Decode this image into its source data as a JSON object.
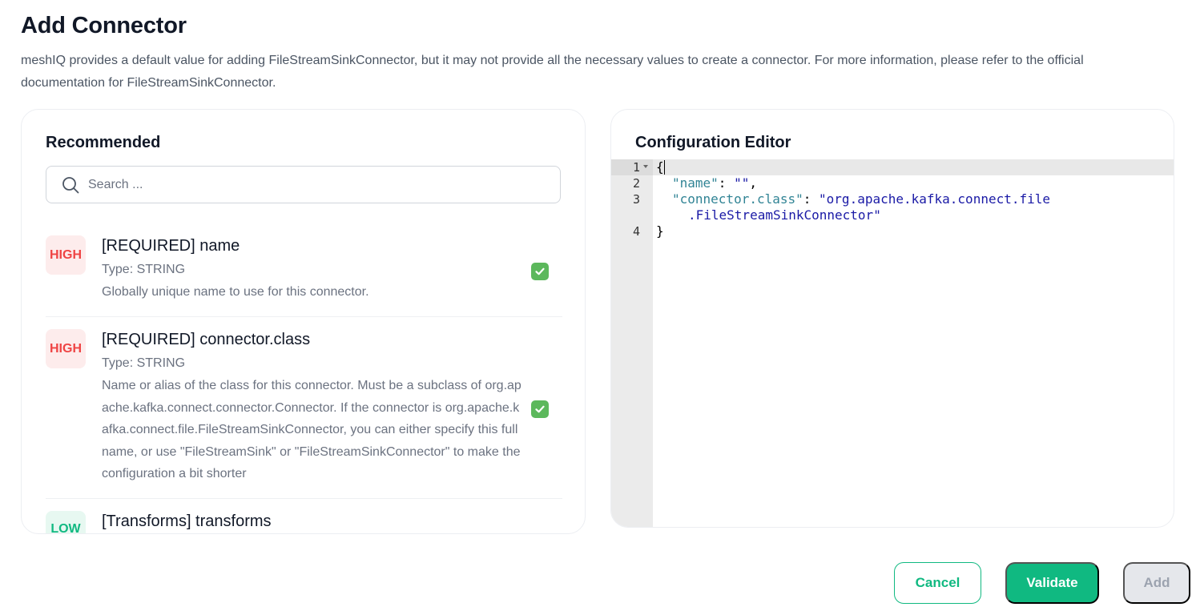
{
  "page": {
    "title": "Add Connector",
    "intro": "meshIQ provides a default value for adding FileStreamSinkConnector, but it may not provide all the necessary values to create a connector. For more information, please refer to the official documentation for FileStreamSinkConnector."
  },
  "recommended": {
    "title": "Recommended",
    "search_placeholder": "Search ...",
    "items": [
      {
        "priority": "HIGH",
        "title": "[REQUIRED] name",
        "type": "Type: STRING",
        "description": "Globally unique name to use for this connector.",
        "checked": true
      },
      {
        "priority": "HIGH",
        "title": "[REQUIRED] connector.class",
        "type": "Type: STRING",
        "description": "Name or alias of the class for this connector. Must be a subclass of org.apache.kafka.connect.connector.Connector. If the connector is org.apache.kafka.connect.file.FileStreamSinkConnector, you can either specify this full name, or use \"FileStreamSink\" or \"FileStreamSinkConnector\" to make the configuration a bit shorter",
        "checked": true
      },
      {
        "priority": "LOW",
        "title": "[Transforms] transforms"
      }
    ]
  },
  "editor": {
    "title": "Configuration Editor",
    "line_numbers": [
      "1",
      "2",
      "3",
      "4"
    ],
    "lines": {
      "l1": "{",
      "l2_key": "\"name\"",
      "l2_sep": ": ",
      "l2_val": "\"\"",
      "l2_end": ",",
      "l3_key": "\"connector.class\"",
      "l3_sep": ": ",
      "l3_val_a": "\"org.apache.kafka.connect.file",
      "l3_val_b": ".FileStreamSinkConnector\"",
      "l4": "}"
    }
  },
  "actions": {
    "cancel": "Cancel",
    "validate": "Validate",
    "add": "Add"
  },
  "colors": {
    "accent": "#10b981",
    "high": "#ef4444",
    "check": "#5cb85c"
  }
}
